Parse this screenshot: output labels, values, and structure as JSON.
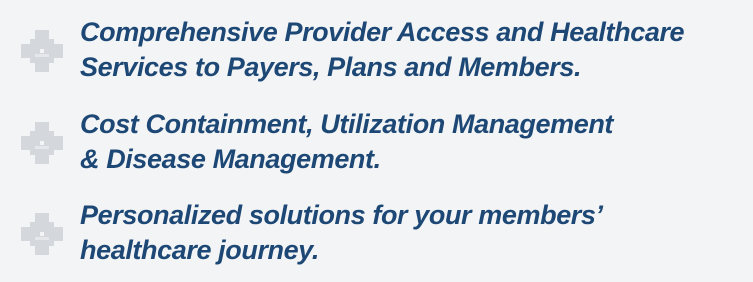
{
  "colors": {
    "background": "#f3f4f5",
    "text": "#1d4876",
    "icon": "#d4d7db"
  },
  "features": [
    {
      "icon": "cross-icon",
      "line1": "Comprehensive Provider Access and Healthcare",
      "line2": "Services to Payers, Plans and Members."
    },
    {
      "icon": "cross-icon",
      "line1": "Cost Containment, Utilization Management",
      "line2": "& Disease Management."
    },
    {
      "icon": "cross-icon",
      "line1": "Personalized solutions for your members’",
      "line2": "healthcare journey."
    }
  ]
}
